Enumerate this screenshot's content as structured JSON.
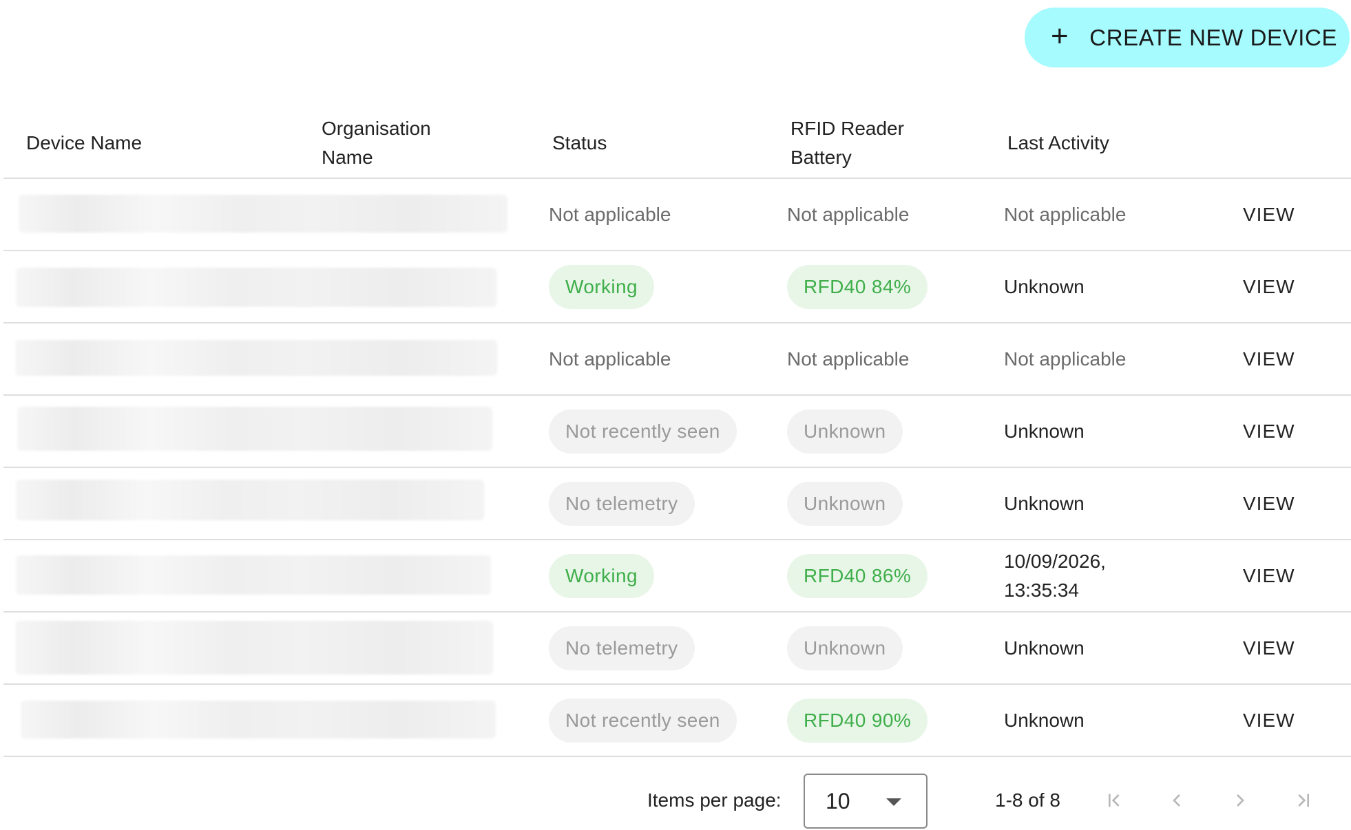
{
  "toolbar": {
    "create_label": "CREATE NEW DEVICE",
    "create_icon": "plus-icon"
  },
  "table": {
    "columns": [
      "Device Name",
      "Organisation\nName",
      "Status",
      "RFID Reader\nBattery",
      "Last Activity"
    ],
    "rows": [
      {
        "status": "Not applicable",
        "status_kind": "text",
        "battery": "Not applicable",
        "battery_kind": "text",
        "last_activity": "Not applicable",
        "activity_kind": "muted",
        "action": "VIEW"
      },
      {
        "status": "Working",
        "status_kind": "green",
        "battery": "RFD40 84%",
        "battery_kind": "green",
        "last_activity": "Unknown",
        "activity_kind": "dark",
        "action": "VIEW"
      },
      {
        "status": "Not applicable",
        "status_kind": "text",
        "battery": "Not applicable",
        "battery_kind": "text",
        "last_activity": "Not applicable",
        "activity_kind": "muted",
        "action": "VIEW"
      },
      {
        "status": "Not recently seen",
        "status_kind": "grey",
        "battery": "Unknown",
        "battery_kind": "grey",
        "last_activity": "Unknown",
        "activity_kind": "dark",
        "action": "VIEW"
      },
      {
        "status": "No telemetry",
        "status_kind": "grey",
        "battery": "Unknown",
        "battery_kind": "grey",
        "last_activity": "Unknown",
        "activity_kind": "dark",
        "action": "VIEW"
      },
      {
        "status": "Working",
        "status_kind": "green",
        "battery": "RFD40 86%",
        "battery_kind": "green",
        "last_activity": "10/09/2026,\n13:35:34",
        "activity_kind": "dark",
        "action": "VIEW"
      },
      {
        "status": "No telemetry",
        "status_kind": "grey",
        "battery": "Unknown",
        "battery_kind": "grey",
        "last_activity": "Unknown",
        "activity_kind": "dark",
        "action": "VIEW"
      },
      {
        "status": "Not recently seen",
        "status_kind": "grey",
        "battery": "RFD40 90%",
        "battery_kind": "green",
        "last_activity": "Unknown",
        "activity_kind": "dark",
        "action": "VIEW"
      }
    ]
  },
  "pagination": {
    "items_per_page_label": "Items per page:",
    "items_per_page_value": "10",
    "range_label": "1-8 of 8"
  },
  "colors": {
    "accent": "#a6fbff",
    "success_text": "#3fae4a",
    "success_bg": "#e8f6e8",
    "neutral_bg": "#f2f2f2",
    "neutral_text": "#9a9a9a"
  }
}
